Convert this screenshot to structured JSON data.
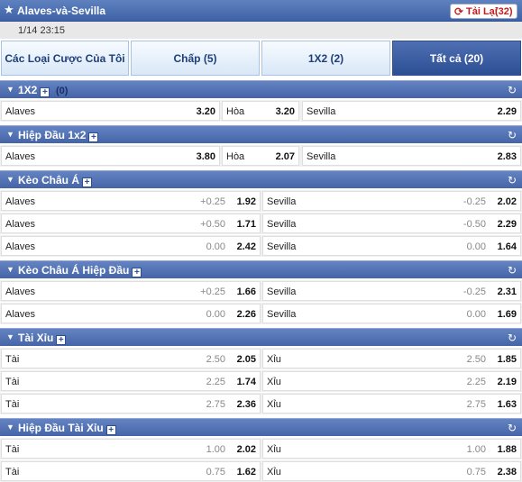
{
  "window": {
    "title": "Alaves-và-Sevilla",
    "reload_label": "Tải Lại",
    "reload_count": "(32)"
  },
  "match_time": "1/14 23:15",
  "tabs": [
    {
      "label": "Các Loại Cược Của Tôi",
      "active": false
    },
    {
      "label": "Chấp (5)",
      "active": false
    },
    {
      "label": "1X2 (2)",
      "active": false
    },
    {
      "label": "Tất cả (20)",
      "active": true
    }
  ],
  "sections": [
    {
      "title": "1X2",
      "count": "(0)",
      "type": "three",
      "rows": [
        {
          "home": "Alaves",
          "home_odds": "3.20",
          "draw": "Hòa",
          "draw_odds": "3.20",
          "away": "Sevilla",
          "away_odds": "2.29"
        }
      ]
    },
    {
      "title": "Hiệp Đầu 1x2",
      "type": "three",
      "rows": [
        {
          "home": "Alaves",
          "home_odds": "3.80",
          "draw": "Hòa",
          "draw_odds": "2.07",
          "away": "Sevilla",
          "away_odds": "2.83"
        }
      ]
    },
    {
      "title": "Kèo Châu Á",
      "type": "two",
      "rows": [
        {
          "left": "Alaves",
          "left_hcp": "+0.25",
          "left_odds": "1.92",
          "right": "Sevilla",
          "right_hcp": "-0.25",
          "right_odds": "2.02"
        },
        {
          "left": "Alaves",
          "left_hcp": "+0.50",
          "left_odds": "1.71",
          "right": "Sevilla",
          "right_hcp": "-0.50",
          "right_odds": "2.29"
        },
        {
          "left": "Alaves",
          "left_hcp": "0.00",
          "left_odds": "2.42",
          "right": "Sevilla",
          "right_hcp": "0.00",
          "right_odds": "1.64"
        }
      ]
    },
    {
      "title": "Kèo Châu Á Hiệp Đầu",
      "type": "two",
      "rows": [
        {
          "left": "Alaves",
          "left_hcp": "+0.25",
          "left_odds": "1.66",
          "right": "Sevilla",
          "right_hcp": "-0.25",
          "right_odds": "2.31"
        },
        {
          "left": "Alaves",
          "left_hcp": "0.00",
          "left_odds": "2.26",
          "right": "Sevilla",
          "right_hcp": "0.00",
          "right_odds": "1.69"
        }
      ]
    },
    {
      "title": "Tài Xỉu",
      "type": "two",
      "rows": [
        {
          "left": "Tài",
          "left_hcp": "2.50",
          "left_odds": "2.05",
          "right": "Xỉu",
          "right_hcp": "2.50",
          "right_odds": "1.85"
        },
        {
          "left": "Tài",
          "left_hcp": "2.25",
          "left_odds": "1.74",
          "right": "Xỉu",
          "right_hcp": "2.25",
          "right_odds": "2.19"
        },
        {
          "left": "Tài",
          "left_hcp": "2.75",
          "left_odds": "2.36",
          "right": "Xỉu",
          "right_hcp": "2.75",
          "right_odds": "1.63"
        }
      ]
    },
    {
      "title": "Hiệp Đầu Tài Xỉu",
      "type": "two",
      "rows": [
        {
          "left": "Tài",
          "left_hcp": "1.00",
          "left_odds": "2.02",
          "right": "Xỉu",
          "right_hcp": "1.00",
          "right_odds": "1.88"
        },
        {
          "left": "Tài",
          "left_hcp": "0.75",
          "left_odds": "1.62",
          "right": "Xỉu",
          "right_hcp": "0.75",
          "right_odds": "2.38"
        }
      ]
    }
  ]
}
